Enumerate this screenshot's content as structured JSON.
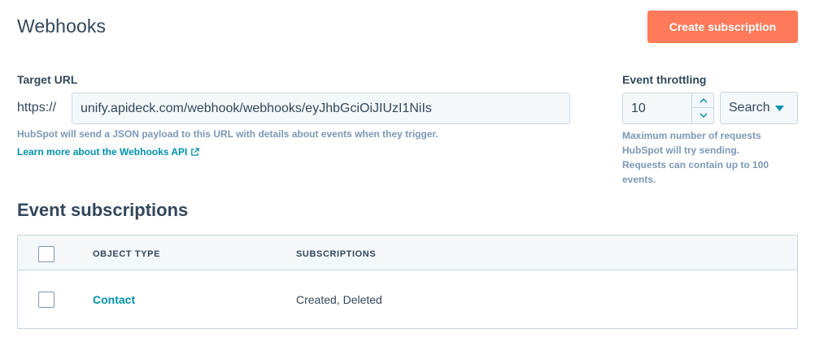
{
  "header": {
    "title": "Webhooks",
    "create_button_label": "Create subscription"
  },
  "target_url": {
    "label": "Target URL",
    "prefix": "https://",
    "value": "unify.apideck.com/webhook/webhooks/eyJhbGciOiJIUzI1NiIs",
    "help_text": "HubSpot will send a JSON payload to this URL with details about events when they trigger.",
    "learn_more_link": "Learn more about the Webhooks API"
  },
  "event_throttling": {
    "label": "Event throttling",
    "value": "10",
    "select_value": "Search",
    "help_text": "Maximum number of requests HubSpot will try sending. Requests can contain up to 100 events."
  },
  "event_subscriptions": {
    "title": "Event subscriptions",
    "columns": [
      "OBJECT TYPE",
      "SUBSCRIPTIONS"
    ],
    "rows": [
      {
        "object_type": "Contact",
        "subscriptions": "Created, Deleted"
      }
    ]
  },
  "colors": {
    "primary_button": "#ff7a59",
    "link": "#0091ae",
    "text": "#33475b",
    "help_text": "#7c98b6",
    "border": "#cbd6e2",
    "input_bg": "#f5f8fa"
  },
  "icons": {
    "external_link": "external-link-icon",
    "stepper_up": "chevron-up-icon",
    "stepper_down": "chevron-down-icon",
    "dropdown": "caret-down-icon"
  }
}
